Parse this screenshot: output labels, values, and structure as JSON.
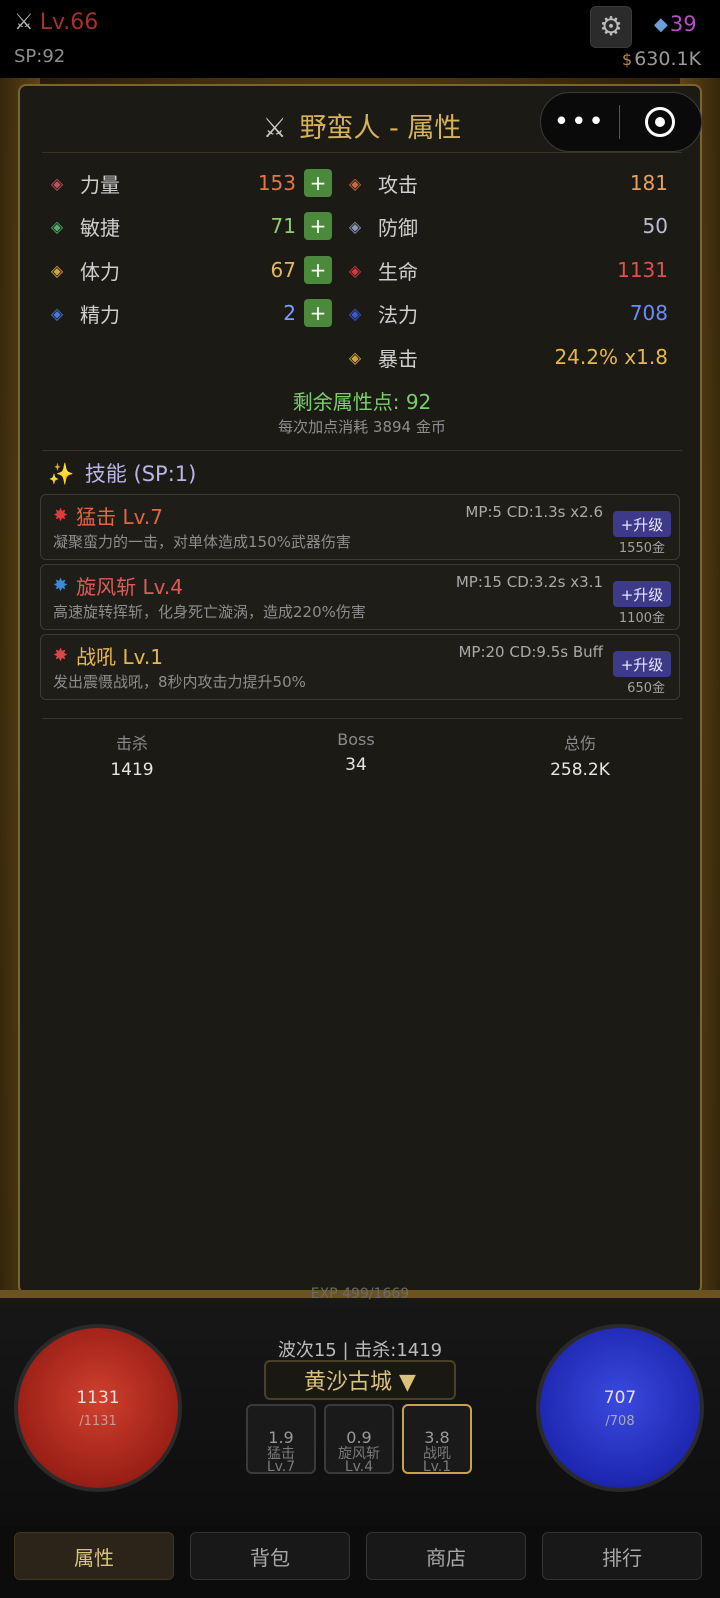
{
  "topbar": {
    "level": "Lv.66",
    "sp": "SP:92",
    "gems": "39",
    "gold": "630.1K"
  },
  "panel": {
    "title": "野蛮人 - 属性",
    "stats_left": [
      {
        "label": "力量",
        "value": "153",
        "color": "#e07840",
        "icon": "sword-icon",
        "iconColor": "#c0505a"
      },
      {
        "label": "敏捷",
        "value": "71",
        "color": "#8bd06a",
        "icon": "feather-icon",
        "iconColor": "#4fae6a"
      },
      {
        "label": "体力",
        "value": "67",
        "color": "#e6b85a",
        "icon": "sun-icon",
        "iconColor": "#d6a04a"
      },
      {
        "label": "精力",
        "value": "2",
        "color": "#7aa0ff",
        "icon": "orb-icon",
        "iconColor": "#4a78d8"
      }
    ],
    "stats_right": [
      {
        "label": "攻击",
        "value": "181",
        "color": "#e6a060",
        "icon": "crossed-swords-icon",
        "iconColor": "#c86a3a"
      },
      {
        "label": "防御",
        "value": "50",
        "color": "#bcbcd6",
        "icon": "shield-icon",
        "iconColor": "#8a98b8"
      },
      {
        "label": "生命",
        "value": "1131",
        "color": "#e05050",
        "icon": "heart-gem-icon",
        "iconColor": "#d43a3a"
      },
      {
        "label": "法力",
        "value": "708",
        "color": "#6a8cff",
        "icon": "mana-gem-icon",
        "iconColor": "#3a5ad8"
      },
      {
        "label": "暴击",
        "value": "24.2%  x1.8",
        "color": "#e6b84a",
        "icon": "crit-icon",
        "iconColor": "#d8a23a"
      }
    ],
    "plus_label": "+",
    "remaining": "剩余属性点: 92",
    "cost_note": "每次加点消耗 3894 金币",
    "skills_title": "技能 (SP:1)",
    "skills": [
      {
        "name": "猛击 Lv.7",
        "nameColor": "#e06840",
        "icon": "burst-icon",
        "iconColor": "#e03a3a",
        "meta": "MP:5 CD:1.3s x2.6",
        "desc": "凝聚蛮力的一击，对单体造成150%武器伤害",
        "up_label": "+升级",
        "up_cost": "1550金"
      },
      {
        "name": "旋风斩 Lv.4",
        "nameColor": "#e05a5a",
        "icon": "cyclone-icon",
        "iconColor": "#3a8ad8",
        "meta": "MP:15 CD:3.2s x3.1",
        "desc": "高速旋转挥斩，化身死亡漩涡，造成220%伤害",
        "up_label": "+升级",
        "up_cost": "1100金"
      },
      {
        "name": "战吼 Lv.1",
        "nameColor": "#e6b84a",
        "icon": "megaphone-icon",
        "iconColor": "#d84a4a",
        "meta": "MP:20 CD:9.5s Buff",
        "desc": "发出震慑战吼，8秒内攻击力提升50%",
        "up_label": "+升级",
        "up_cost": "650金"
      }
    ],
    "summary": [
      {
        "label": "击杀",
        "value": "1419"
      },
      {
        "label": "Boss",
        "value": "34"
      },
      {
        "label": "总伤",
        "value": "258.2K"
      }
    ]
  },
  "hud": {
    "exp": "EXP 499/1669",
    "hp_cur": "1131",
    "hp_max": "/1131",
    "mp_cur": "707",
    "mp_max": "/708",
    "wave": "波次15 | 击杀:1419",
    "zone": "黄沙古城 ▼",
    "slots": [
      {
        "cd": "1.9",
        "name": "猛击",
        "lv": "Lv.7"
      },
      {
        "cd": "0.9",
        "name": "旋风斩",
        "lv": "Lv.4"
      },
      {
        "cd": "3.8",
        "name": "战吼",
        "lv": "Lv.1"
      }
    ]
  },
  "tabs": [
    "属性",
    "背包",
    "商店",
    "排行"
  ]
}
